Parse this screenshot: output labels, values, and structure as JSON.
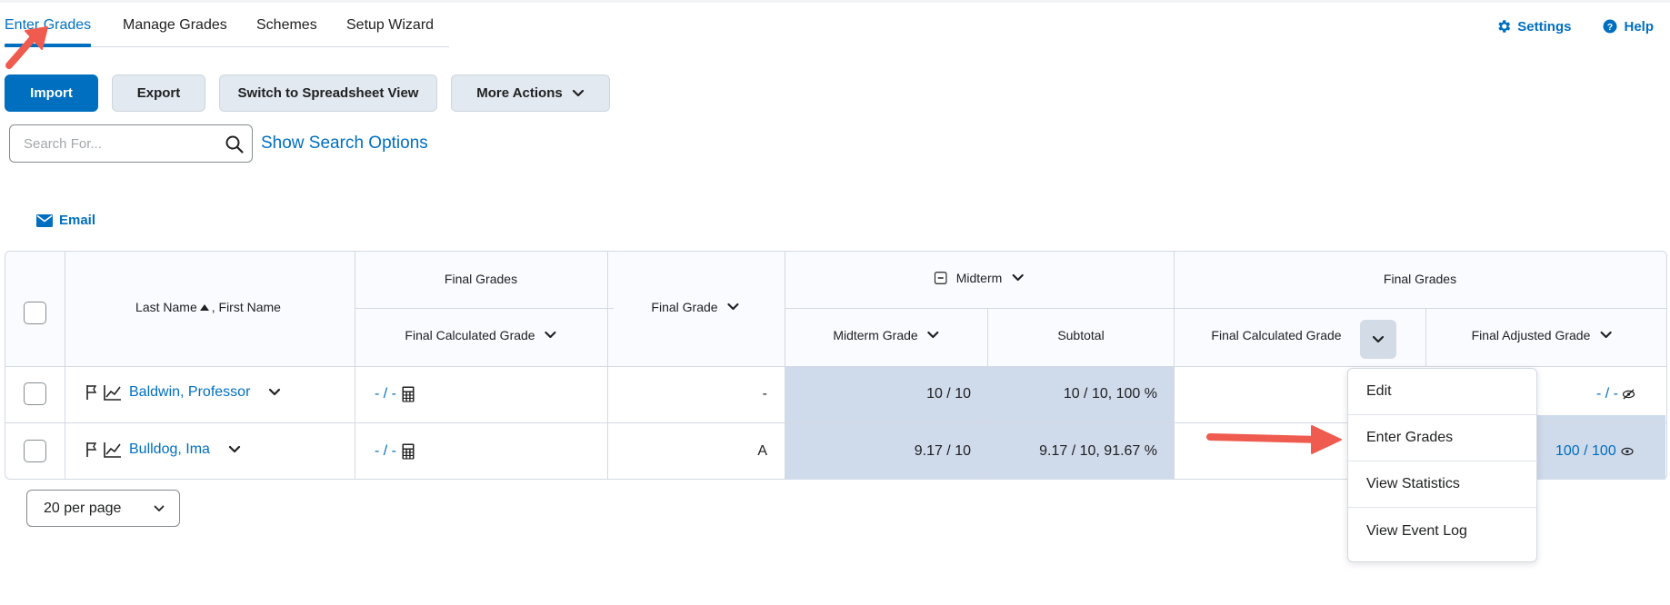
{
  "tabs": [
    {
      "label": "Enter Grades",
      "active": true
    },
    {
      "label": "Manage Grades"
    },
    {
      "label": "Schemes"
    },
    {
      "label": "Setup Wizard"
    }
  ],
  "top_links": {
    "settings": "Settings",
    "help": "Help"
  },
  "toolbar": {
    "import": "Import",
    "export": "Export",
    "spreadsheet": "Switch to Spreadsheet View",
    "more_actions": "More Actions"
  },
  "search": {
    "placeholder": "Search For...",
    "options_link": "Show Search Options"
  },
  "email": "Email",
  "grid": {
    "headers": {
      "name": "Last Name",
      "name_second": ", First Name",
      "final_grades_group_1": "Final Grades",
      "final_calculated_grade_1": "Final Calculated Grade",
      "final_grade": "Final Grade",
      "midterm_group": "Midterm",
      "midterm_grade": "Midterm Grade",
      "subtotal": "Subtotal",
      "final_grades_group_2": "Final Grades",
      "final_calculated_grade_2": "Final Calculated Grade",
      "final_adjusted_grade": "Final Adjusted Grade"
    },
    "rows": [
      {
        "name": "Baldwin, Professor",
        "calc_grade": "- / -",
        "final_grade": "-",
        "midterm_grade": "10 / 10",
        "subtotal": "10 / 10, 100 %",
        "adjusted": "- / -"
      },
      {
        "name": "Bulldog, Ima",
        "calc_grade": "- / -",
        "final_grade": "A",
        "midterm_grade": "9.17 / 10",
        "subtotal": "9.17 / 10, 91.67 %",
        "adjusted": "100 / 100"
      }
    ]
  },
  "context_menu": {
    "items": [
      "Edit",
      "Enter Grades",
      "View Statistics",
      "View Event Log"
    ]
  },
  "pagination": {
    "per_page": "20 per page"
  },
  "colors": {
    "accent": "#006fbf",
    "highlight": "#cfdaeb",
    "annotation_arrow": "#ef5b4f"
  }
}
